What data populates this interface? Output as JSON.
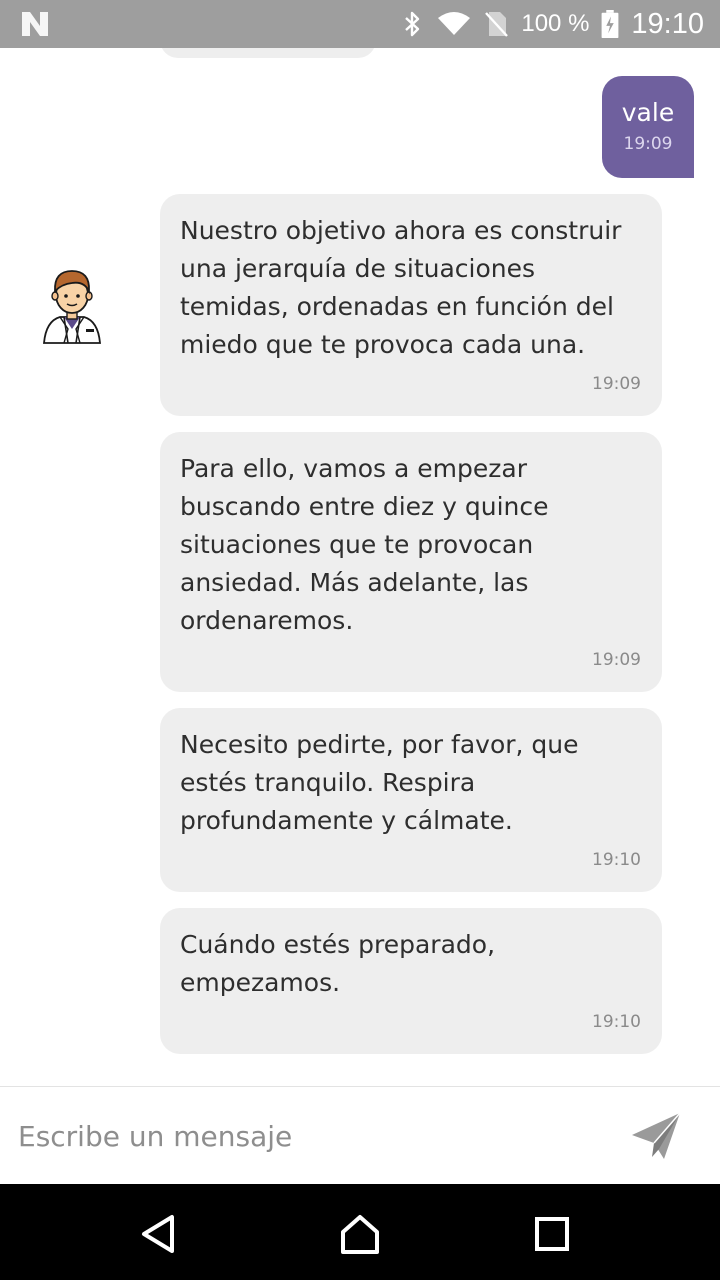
{
  "status_bar": {
    "battery_text": "100 %",
    "time": "19:10",
    "icons": [
      "n-logo-icon",
      "bluetooth-icon",
      "wifi-icon",
      "no-sim-icon",
      "battery-charging-icon"
    ]
  },
  "chat": {
    "user_message": {
      "text": "vale",
      "time": "19:09",
      "color": "#6f609e"
    },
    "bot_messages": [
      {
        "text": "Nuestro objetivo ahora es construir una jerarquía de situaciones temidas, ordenadas en función del miedo que te provoca cada una.",
        "time": "19:09"
      },
      {
        "text": "Para ello, vamos a empezar buscando entre diez y quince situaciones que te provocan ansiedad. Más adelante, las ordenaremos.",
        "time": "19:09"
      },
      {
        "text": "Necesito pedirte, por favor, que estés tranquilo. Respira profundamente y cálmate.",
        "time": "19:10"
      },
      {
        "text": "Cuándo estés preparado, empezamos.",
        "time": "19:10"
      }
    ],
    "avatar_icon": "doctor-avatar-icon"
  },
  "composer": {
    "placeholder": "Escribe un mensaje",
    "value": "",
    "send_icon": "send-icon"
  },
  "nav_bar": {
    "icons": [
      "back-icon",
      "home-icon",
      "recents-icon"
    ]
  }
}
